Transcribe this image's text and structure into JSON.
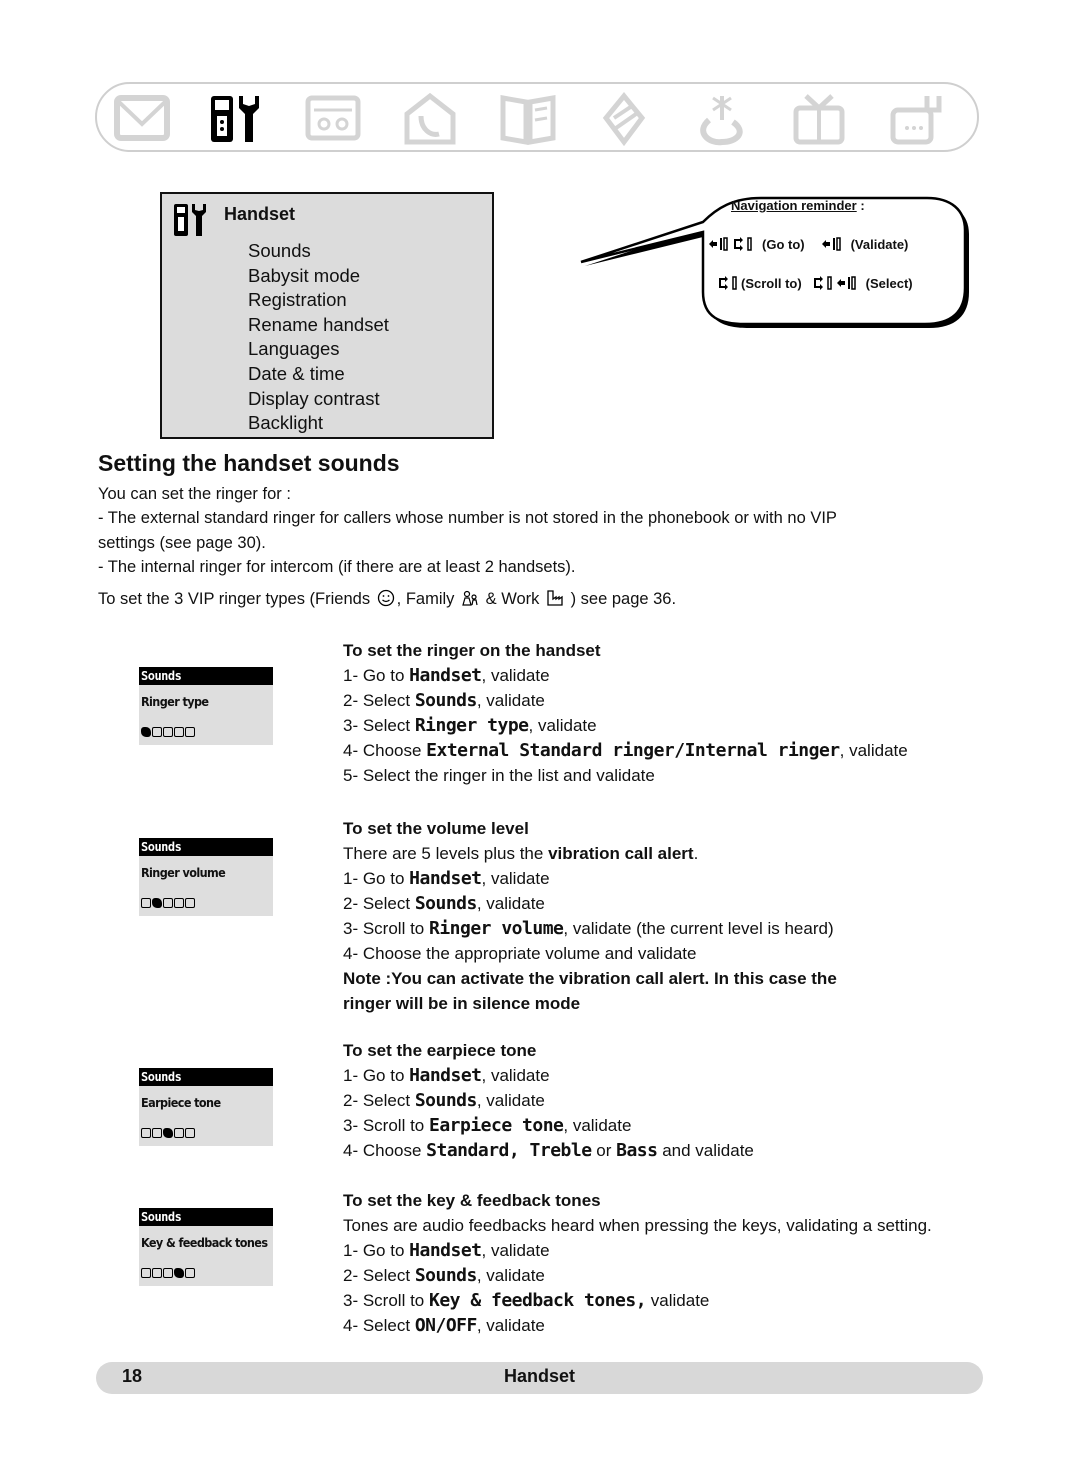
{
  "icon_bar": {
    "icons": [
      {
        "name": "messages-icon",
        "active": false
      },
      {
        "name": "handset-settings-icon",
        "active": true
      },
      {
        "name": "answering-machine-icon",
        "active": false
      },
      {
        "name": "base-settings-icon",
        "active": false
      },
      {
        "name": "phonebook-icon",
        "active": false
      },
      {
        "name": "calls-list-icon",
        "active": false
      },
      {
        "name": "alarm-icon",
        "active": false
      },
      {
        "name": "extras-icon",
        "active": false
      },
      {
        "name": "services-icon",
        "active": false
      }
    ]
  },
  "menu_box": {
    "title": "Handset",
    "icon": "handset-settings-icon",
    "items": [
      "Sounds",
      "Babysit mode",
      "Registration",
      "Rename handset",
      "Languages",
      "Date & time",
      "Display contrast",
      "Backlight"
    ]
  },
  "nav_reminder": {
    "title": "Navigation reminder",
    "title_suffix": " :",
    "goto_label": "(Go to)",
    "validate_label": "(Validate)",
    "scroll_label": "(Scroll to)",
    "select_label": "(Select)"
  },
  "section": {
    "title": "Setting the handset sounds",
    "intro": [
      "You can set the ringer for :",
      "- The external standard ringer for callers whose number is not stored in the phonebook or with no VIP",
      "settings (see page 30).",
      "- The internal ringer for intercom (if there are at least 2 handsets)."
    ],
    "vip": {
      "prefix": "To set the 3 VIP ringer types (Friends ",
      "family": ", Family ",
      "work": "  & Work ",
      "suffix": " ) see page 36."
    }
  },
  "screens": [
    {
      "header": "Sounds",
      "item": "Ringer type",
      "level_count": 5,
      "selected_level": 1
    },
    {
      "header": "Sounds",
      "item": "Ringer volume",
      "level_count": 5,
      "selected_level": 2
    },
    {
      "header": "Sounds",
      "item": "Earpiece tone",
      "level_count": 5,
      "selected_level": 3
    },
    {
      "header": "Sounds",
      "item": "Key & feedback tones",
      "level_count": 5,
      "selected_level": 4
    }
  ],
  "blocks": {
    "ringer": {
      "heading": "To set the ringer on the handset",
      "s1_pre": "1- Go to ",
      "s1_key": "Handset",
      "s1_post": ", validate",
      "s2_pre": "2- Select ",
      "s2_key": "Sounds",
      "s2_post": ", validate",
      "s3_pre": "3- Select ",
      "s3_key": "Ringer type",
      "s3_post": ", validate",
      "s4_pre": "4- Choose ",
      "s4_key": "External Standard ringer/Internal ringer",
      "s4_post": ", validate",
      "s5": "5- Select the ringer in the list and validate"
    },
    "volume": {
      "heading": "To set the volume level",
      "intro_pre": "There are 5 levels plus the ",
      "intro_bold": "vibration call alert",
      "intro_post": ".",
      "s1_pre": "1- Go to ",
      "s1_key": "Handset",
      "s1_post": ", validate",
      "s2_pre": "2- Select ",
      "s2_key": "Sounds",
      "s2_post": ", validate",
      "s3_pre": "3- Scroll to ",
      "s3_key": "Ringer volume",
      "s3_post": ", validate (the current level is heard)",
      "s4": "4- Choose the appropriate volume and validate",
      "note1": "Note :You can activate the vibration call alert. In this case the",
      "note2": "ringer will be in silence mode"
    },
    "earpiece": {
      "heading": "To set the earpiece tone",
      "s1_pre": "1- Go to ",
      "s1_key": "Handset",
      "s1_post": ", validate",
      "s2_pre": "2- Select ",
      "s2_key": "Sounds",
      "s2_post": ", validate",
      "s3_pre": "3- Scroll to ",
      "s3_key": "Earpiece tone",
      "s3_post": ", validate",
      "s4_pre": "4- Choose ",
      "s4_key1": "Standard, Treble",
      "s4_mid": " or ",
      "s4_key2": "Bass",
      "s4_post": " and validate"
    },
    "keytones": {
      "heading": "To set the key & feedback tones",
      "intro": "Tones are audio feedbacks heard when pressing the keys, validating a setting.",
      "s1_pre": "1- Go to ",
      "s1_key": "Handset",
      "s1_post": ", validate",
      "s2_pre": "2- Select ",
      "s2_key": "Sounds",
      "s2_post": ", validate",
      "s3_pre": "3- Scroll to ",
      "s3_key": "Key & feedback tones,",
      "s3_post": " validate",
      "s4_pre": "4- Select ",
      "s4_key": "ON/OFF",
      "s4_post": ", validate"
    }
  },
  "footer": {
    "page_number": "18",
    "title": "Handset"
  },
  "colors": {
    "inactive_icon": "#d4d4d4",
    "active_icon": "#000000",
    "menu_bg": "#dcdcdc",
    "footer_bg": "#d8d8d8",
    "lcd_bg": "#dedede"
  }
}
